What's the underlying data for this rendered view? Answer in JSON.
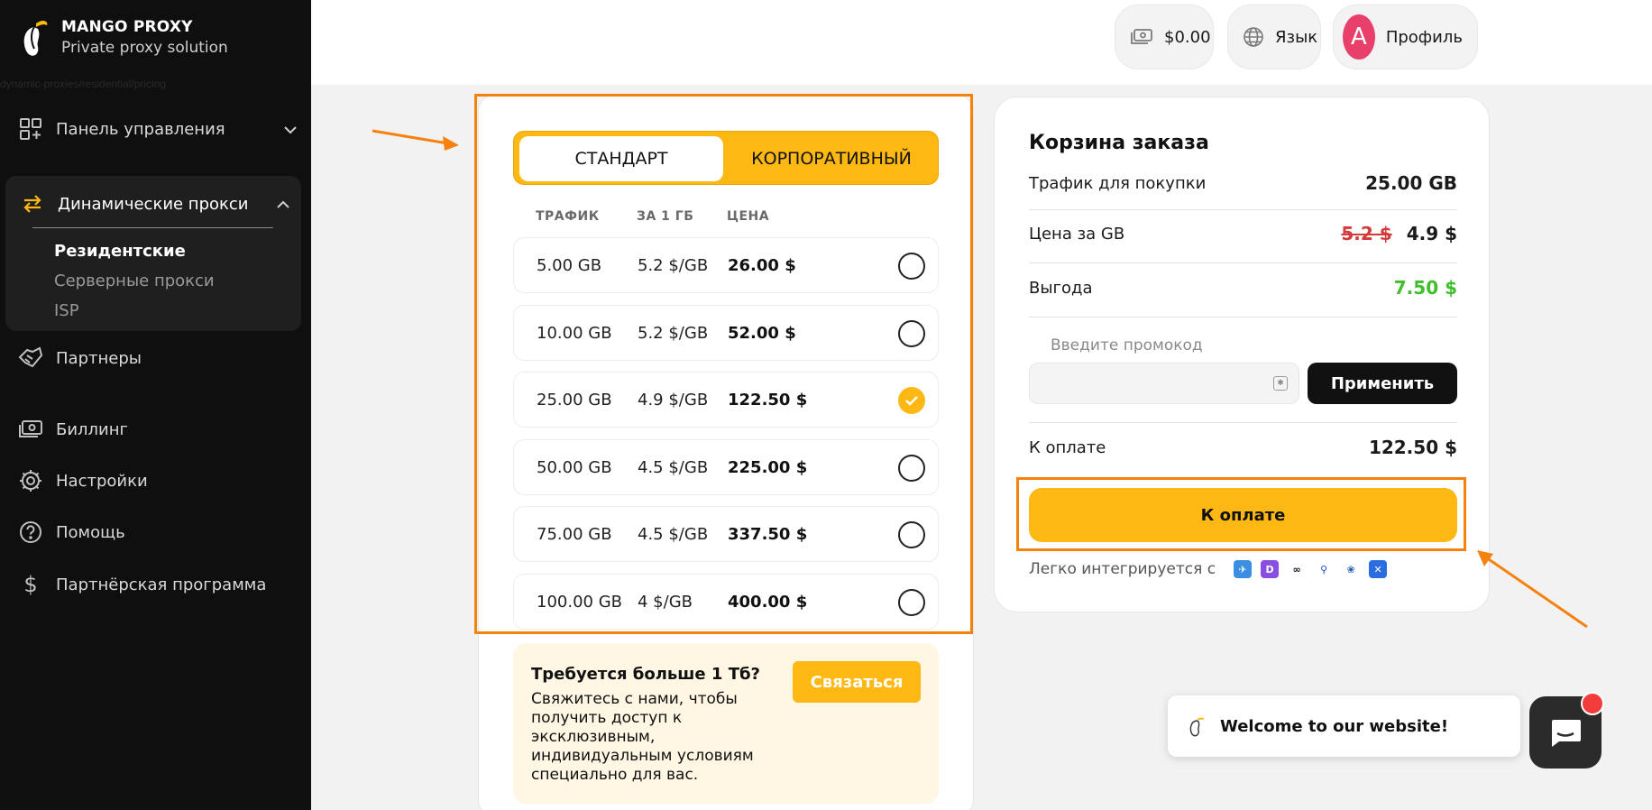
{
  "sidebar": {
    "logo_title": "MANGO PROXY",
    "logo_subtitle": "Private proxy solution",
    "url_hint": "dynamic-proxies/residential/pricing",
    "items": {
      "dashboard": "Панель управления",
      "dynamic": "Динамические прокси",
      "partners": "Партнеры",
      "billing": "Биллинг",
      "settings": "Настройки",
      "help": "Помощь",
      "affiliate": "Партнёрская программа"
    },
    "sub_items": [
      "Резидентские",
      "Серверные прокси",
      "ISP"
    ]
  },
  "topbar": {
    "balance": "$0.00",
    "language": "Язык",
    "avatar_letter": "A",
    "profile": "Профиль"
  },
  "plans": {
    "tab_standard": "СТАНДАРТ",
    "tab_corporate": "КОРПОРАТИВНЫЙ",
    "headers": [
      "ТРАФИК",
      "ЗА 1 ГБ",
      "ЦЕНА"
    ],
    "rows": [
      {
        "traffic": "5.00 GB",
        "per_gb": "5.2 $/GB",
        "price": "26.00 $",
        "selected": false
      },
      {
        "traffic": "10.00 GB",
        "per_gb": "5.2 $/GB",
        "price": "52.00 $",
        "selected": false
      },
      {
        "traffic": "25.00 GB",
        "per_gb": "4.9 $/GB",
        "price": "122.50 $",
        "selected": true
      },
      {
        "traffic": "50.00 GB",
        "per_gb": "4.5 $/GB",
        "price": "225.00 $",
        "selected": false
      },
      {
        "traffic": "75.00 GB",
        "per_gb": "4.5 $/GB",
        "price": "337.50 $",
        "selected": false
      },
      {
        "traffic": "100.00 GB",
        "per_gb": "4 $/GB",
        "price": "400.00 $",
        "selected": false
      }
    ],
    "promo_title": "Требуется больше 1 Тб?",
    "promo_text": "Свяжитесь с нами, чтобы получить доступ к эксклюзивным, индивидуальным условиям специально для вас.",
    "contact_button": "Связаться"
  },
  "cart": {
    "title": "Корзина заказа",
    "traffic_label": "Трафик для покупки",
    "traffic_value": "25.00 GB",
    "price_label": "Цена за GB",
    "price_old": "5.2 $",
    "price_new": "4.9 $",
    "savings_label": "Выгода",
    "savings_value": "7.50 $",
    "promo_placeholder": "Введите промокод",
    "apply_button": "Применить",
    "total_label": "К оплате",
    "total_value": "122.50 $",
    "pay_button": "К оплате",
    "integrates_text": "Легко интегрируется с"
  },
  "chat": {
    "welcome": "Welcome to our website!"
  },
  "colors": {
    "accent": "#fdb813",
    "highlight": "#f5820f",
    "sidebar_bg": "#0f0f0f",
    "savings": "#3fbf2a"
  }
}
